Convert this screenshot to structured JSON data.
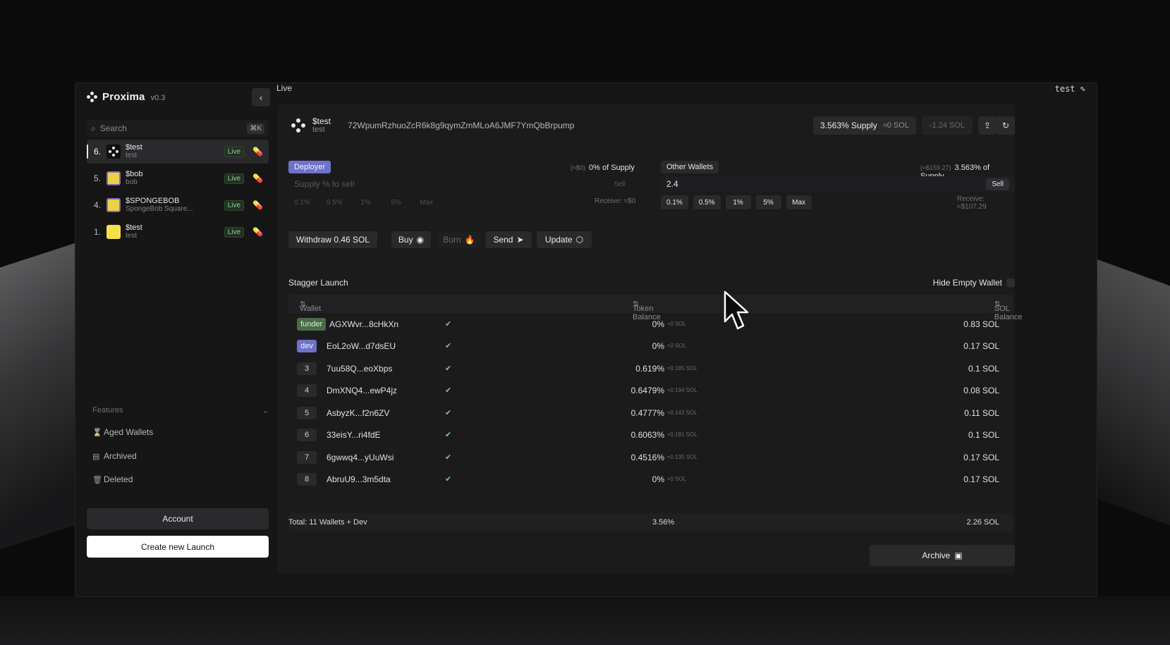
{
  "app": {
    "name": "Proxima",
    "version": "v0.3"
  },
  "header": {
    "title": "Live",
    "user": "test"
  },
  "search": {
    "placeholder": "Search",
    "shortcut": "⌘K"
  },
  "launches": [
    {
      "num": "6.",
      "title": "$test",
      "sub": "test",
      "badge": "Live",
      "avatar": "dark",
      "active": true
    },
    {
      "num": "5.",
      "title": "$bob",
      "sub": "bob",
      "badge": "Live",
      "avatar": "sponge",
      "active": false
    },
    {
      "num": "4.",
      "title": "$SPONGEBOB",
      "sub": "SpongeBob Square...",
      "badge": "Live",
      "avatar": "sponge",
      "active": false
    },
    {
      "num": "1.",
      "title": "$test",
      "sub": "test",
      "badge": "Live",
      "avatar": "yellow",
      "active": false
    }
  ],
  "features": {
    "label": "Features",
    "items": [
      {
        "label": "Aged Wallets",
        "icon": "hourglass-icon"
      },
      {
        "label": "Archived",
        "icon": "archive-icon"
      },
      {
        "label": "Deleted",
        "icon": "trash-icon"
      }
    ]
  },
  "sidebar_buttons": {
    "account": "Account",
    "create": "Create new Launch"
  },
  "token": {
    "symbol": "$test",
    "sub": "test",
    "ca": "72WpumRzhuoZcR6k8g9qymZmMLoA6JMF7YmQbBrpump",
    "supply": "3.563% Supply",
    "supply_sol": "≈0 SOL",
    "pnl": "-1.24 SOL"
  },
  "deployer": {
    "tag": "Deployer",
    "note_ghost": "(≈$0)",
    "note": "0% of Supply",
    "placeholder": "Supply % to sell",
    "sell": "Sell",
    "pcts": [
      "0.1%",
      "0.5%",
      "1%",
      "5%",
      "Max"
    ],
    "receive": "Receive: ≈$0"
  },
  "other": {
    "tag": "Other Wallets",
    "note_ghost": "(≈$159.27)",
    "note": "3.563% of Supply",
    "value": "2.4",
    "sell": "Sell",
    "pcts": [
      "0.1%",
      "0.5%",
      "1%",
      "5%",
      "Max"
    ],
    "receive": "Receive: ≈$107.29"
  },
  "actions": {
    "withdraw": "Withdraw 0.46 SOL",
    "buy": "Buy",
    "burn": "Burn",
    "send": "Send",
    "update": "Update"
  },
  "stagger": {
    "title": "Stagger Launch",
    "hide_empty": "Hide Empty Wallet",
    "columns": {
      "wallet": "Wallet",
      "token": "Token Balance",
      "sol": "SOL Balance"
    },
    "rows": [
      {
        "idx": "funder",
        "kind": "funder",
        "addr": "AGXWvr...8cHkXn",
        "pct": "0%",
        "sol_small": "≈0 SOL",
        "sol": "0.83 SOL"
      },
      {
        "idx": "dev",
        "kind": "dev",
        "addr": "EoL2oW...d7dsEU",
        "pct": "0%",
        "sol_small": "≈0 SOL",
        "sol": "0.17 SOL"
      },
      {
        "idx": "3",
        "kind": "num",
        "addr": "7uu58Q...eoXbps",
        "pct": "0.619%",
        "sol_small": "≈0.185 SOL",
        "sol": "0.1 SOL"
      },
      {
        "idx": "4",
        "kind": "num",
        "addr": "DmXNQ4...ewP4jz",
        "pct": "0.6479%",
        "sol_small": "≈0.194 SOL",
        "sol": "0.08 SOL"
      },
      {
        "idx": "5",
        "kind": "num",
        "addr": "AsbyzK...f2n6ZV",
        "pct": "0.4777%",
        "sol_small": "≈0.143 SOL",
        "sol": "0.11 SOL"
      },
      {
        "idx": "6",
        "kind": "num",
        "addr": "33eisY...ri4fdE",
        "pct": "0.6063%",
        "sol_small": "≈0.181 SOL",
        "sol": "0.1 SOL"
      },
      {
        "idx": "7",
        "kind": "num",
        "addr": "6gwwq4...yUuWsi",
        "pct": "0.4516%",
        "sol_small": "≈0.135 SOL",
        "sol": "0.17 SOL"
      },
      {
        "idx": "8",
        "kind": "num",
        "addr": "AbruU9...3m5dta",
        "pct": "0%",
        "sol_small": "≈0 SOL",
        "sol": "0.17 SOL"
      }
    ],
    "total": {
      "label": "Total: 11 Wallets + Dev",
      "pct": "3.56%",
      "sol": "2.26 SOL"
    }
  },
  "archive": "Archive",
  "colors": {
    "live_green": "#8ed58e",
    "deployer_purple": "#6e72c9",
    "check_green": "#6fcf7f"
  }
}
